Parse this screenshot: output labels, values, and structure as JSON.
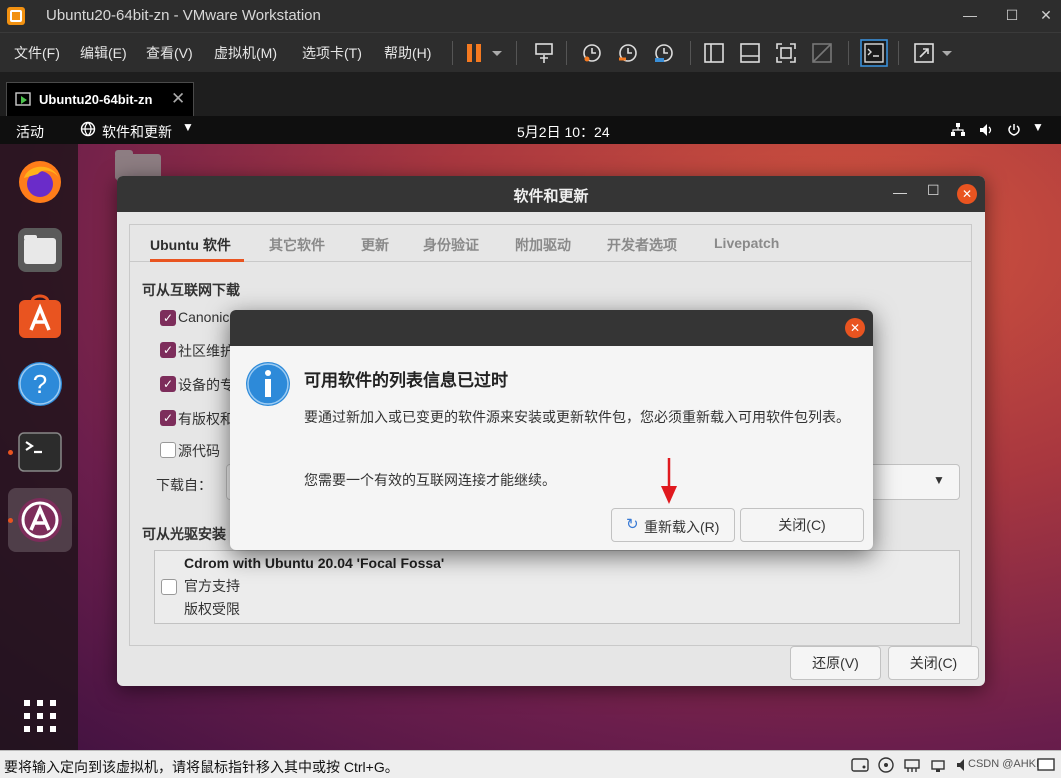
{
  "window": {
    "title": "Ubuntu20-64bit-zn - VMware Workstation",
    "min": "—",
    "max": "☐",
    "close": "✕"
  },
  "menu": [
    "文件(F)",
    "编辑(E)",
    "查看(V)",
    "虚拟机(M)",
    "选项卡(T)",
    "帮助(H)"
  ],
  "tab": {
    "label": "Ubuntu20-64bit-zn",
    "close": "✕"
  },
  "gnome": {
    "activities": "活动",
    "app_menu": "软件和更新",
    "clock": "5月2日  10：24"
  },
  "sw": {
    "title": "软件和更新",
    "tabs": [
      "Ubuntu 软件",
      "其它软件",
      "更新",
      "身份验证",
      "附加驱动",
      "开发者选项",
      "Livepatch"
    ],
    "section_internet": "可从互联网下载",
    "checkboxes": [
      "Canonic",
      "社区维护",
      "设备的专",
      "有版权和",
      "源代码"
    ],
    "download_from": "下载自：",
    "section_cdrom": "可从光驱安装",
    "cdrom_title": "Cdrom with Ubuntu 20.04 'Focal Fossa'",
    "cdrom_line1": "官方支持",
    "cdrom_line2": "版权受限",
    "revert_button": "还原(V)",
    "close_button": "关闭(C)"
  },
  "dialog": {
    "heading": "可用软件的列表信息已过时",
    "body": "要通过新加入或已变更的软件源来安装或更新软件包，您必须重新载入可用软件包列表。",
    "note": "您需要一个有效的互联网连接才能继续。",
    "reload_button": "重新载入(R)",
    "close_button": "关闭(C)"
  },
  "statusbar": {
    "message": "要将输入定向到该虚拟机，请将鼠标指针移入其中或按 Ctrl+G。",
    "watermark": "CSDN @AHKIT."
  },
  "colors": {
    "ubuntu_orange": "#e95420",
    "aubergine": "#7d2d5b",
    "arrow_red": "#e0191e"
  }
}
